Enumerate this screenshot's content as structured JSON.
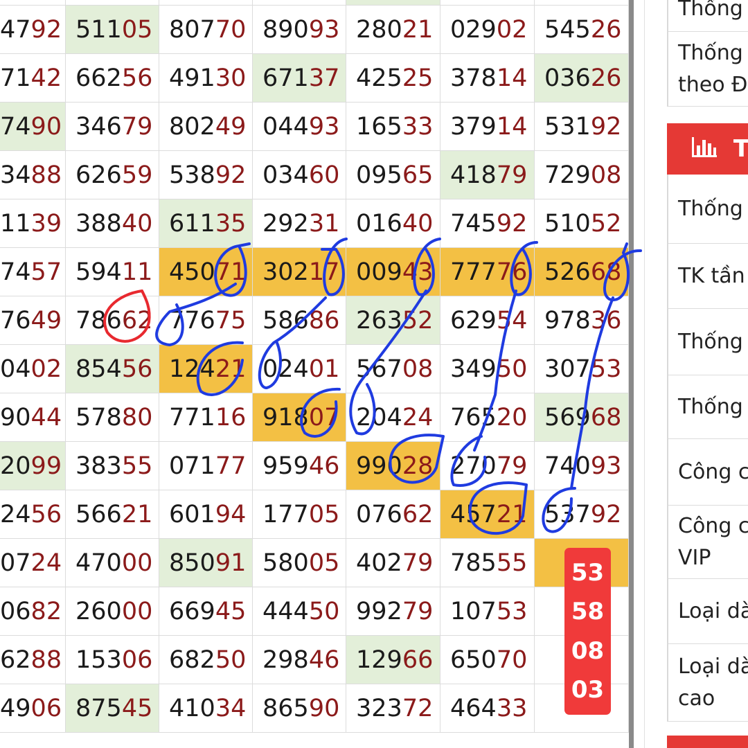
{
  "colors": {
    "tail_digits": "#8b1a1a",
    "highlight_gold": "#f3c044",
    "highlight_green": "#e3efd9",
    "header_red": "#e53935",
    "badge_red": "#f03a3a",
    "ink_blue": "#1f3be0",
    "ink_red": "#e8292f"
  },
  "rows": [
    {
      "cells": [
        {
          "head": "47",
          "tail": "92",
          "hl": ""
        },
        {
          "head": "511",
          "tail": "05",
          "hl": "green"
        },
        {
          "head": "807",
          "tail": "70",
          "hl": ""
        },
        {
          "head": "890",
          "tail": "93",
          "hl": ""
        },
        {
          "head": "280",
          "tail": "21",
          "hl": ""
        },
        {
          "head": "029",
          "tail": "02",
          "hl": ""
        },
        {
          "head": "545",
          "tail": "26",
          "hl": ""
        }
      ]
    },
    {
      "cells": [
        {
          "head": "71",
          "tail": "42",
          "hl": ""
        },
        {
          "head": "662",
          "tail": "56",
          "hl": ""
        },
        {
          "head": "491",
          "tail": "30",
          "hl": ""
        },
        {
          "head": "671",
          "tail": "37",
          "hl": "green"
        },
        {
          "head": "425",
          "tail": "25",
          "hl": ""
        },
        {
          "head": "378",
          "tail": "14",
          "hl": ""
        },
        {
          "head": "036",
          "tail": "26",
          "hl": "green"
        }
      ]
    },
    {
      "cells": [
        {
          "head": "74",
          "tail": "90",
          "hl": "green"
        },
        {
          "head": "346",
          "tail": "79",
          "hl": ""
        },
        {
          "head": "802",
          "tail": "49",
          "hl": ""
        },
        {
          "head": "044",
          "tail": "93",
          "hl": ""
        },
        {
          "head": "165",
          "tail": "33",
          "hl": ""
        },
        {
          "head": "379",
          "tail": "14",
          "hl": ""
        },
        {
          "head": "531",
          "tail": "92",
          "hl": ""
        }
      ]
    },
    {
      "cells": [
        {
          "head": "34",
          "tail": "88",
          "hl": ""
        },
        {
          "head": "626",
          "tail": "59",
          "hl": ""
        },
        {
          "head": "538",
          "tail": "92",
          "hl": ""
        },
        {
          "head": "034",
          "tail": "60",
          "hl": ""
        },
        {
          "head": "095",
          "tail": "65",
          "hl": ""
        },
        {
          "head": "418",
          "tail": "79",
          "hl": "green"
        },
        {
          "head": "729",
          "tail": "08",
          "hl": ""
        }
      ]
    },
    {
      "cells": [
        {
          "head": "11",
          "tail": "39",
          "hl": ""
        },
        {
          "head": "388",
          "tail": "40",
          "hl": ""
        },
        {
          "head": "611",
          "tail": "35",
          "hl": "green"
        },
        {
          "head": "292",
          "tail": "31",
          "hl": ""
        },
        {
          "head": "016",
          "tail": "40",
          "hl": ""
        },
        {
          "head": "745",
          "tail": "92",
          "hl": ""
        },
        {
          "head": "510",
          "tail": "52",
          "hl": ""
        }
      ]
    },
    {
      "cells": [
        {
          "head": "74",
          "tail": "57",
          "hl": ""
        },
        {
          "head": "594",
          "tail": "11",
          "hl": ""
        },
        {
          "head": "450",
          "tail": "71",
          "hl": "gold"
        },
        {
          "head": "302",
          "tail": "17",
          "hl": "gold"
        },
        {
          "head": "009",
          "tail": "43",
          "hl": "gold"
        },
        {
          "head": "777",
          "tail": "76",
          "hl": "gold"
        },
        {
          "head": "526",
          "tail": "68",
          "hl": "gold"
        }
      ]
    },
    {
      "cells": [
        {
          "head": "76",
          "tail": "49",
          "hl": ""
        },
        {
          "head": "786",
          "tail": "62",
          "hl": ""
        },
        {
          "head": "776",
          "tail": "75",
          "hl": ""
        },
        {
          "head": "586",
          "tail": "86",
          "hl": ""
        },
        {
          "head": "263",
          "tail": "52",
          "hl": "green"
        },
        {
          "head": "629",
          "tail": "54",
          "hl": ""
        },
        {
          "head": "978",
          "tail": "36",
          "hl": ""
        }
      ]
    },
    {
      "cells": [
        {
          "head": "04",
          "tail": "02",
          "hl": ""
        },
        {
          "head": "854",
          "tail": "56",
          "hl": "green"
        },
        {
          "head": "124",
          "tail": "21",
          "hl": "gold"
        },
        {
          "head": "024",
          "tail": "01",
          "hl": ""
        },
        {
          "head": "567",
          "tail": "08",
          "hl": ""
        },
        {
          "head": "349",
          "tail": "50",
          "hl": ""
        },
        {
          "head": "307",
          "tail": "53",
          "hl": ""
        }
      ]
    },
    {
      "cells": [
        {
          "head": "90",
          "tail": "44",
          "hl": ""
        },
        {
          "head": "578",
          "tail": "80",
          "hl": ""
        },
        {
          "head": "771",
          "tail": "16",
          "hl": ""
        },
        {
          "head": "918",
          "tail": "07",
          "hl": "gold"
        },
        {
          "head": "204",
          "tail": "24",
          "hl": ""
        },
        {
          "head": "765",
          "tail": "20",
          "hl": ""
        },
        {
          "head": "569",
          "tail": "68",
          "hl": "green"
        }
      ]
    },
    {
      "cells": [
        {
          "head": "20",
          "tail": "99",
          "hl": "green"
        },
        {
          "head": "383",
          "tail": "55",
          "hl": ""
        },
        {
          "head": "071",
          "tail": "77",
          "hl": ""
        },
        {
          "head": "959",
          "tail": "46",
          "hl": ""
        },
        {
          "head": "990",
          "tail": "28",
          "hl": "gold"
        },
        {
          "head": "270",
          "tail": "79",
          "hl": ""
        },
        {
          "head": "740",
          "tail": "93",
          "hl": ""
        }
      ]
    },
    {
      "cells": [
        {
          "head": "24",
          "tail": "56",
          "hl": ""
        },
        {
          "head": "566",
          "tail": "21",
          "hl": ""
        },
        {
          "head": "601",
          "tail": "94",
          "hl": ""
        },
        {
          "head": "177",
          "tail": "05",
          "hl": ""
        },
        {
          "head": "076",
          "tail": "62",
          "hl": ""
        },
        {
          "head": "457",
          "tail": "21",
          "hl": "gold"
        },
        {
          "head": "537",
          "tail": "92",
          "hl": ""
        }
      ]
    },
    {
      "cells": [
        {
          "head": "07",
          "tail": "24",
          "hl": ""
        },
        {
          "head": "470",
          "tail": "00",
          "hl": ""
        },
        {
          "head": "850",
          "tail": "91",
          "hl": "green"
        },
        {
          "head": "580",
          "tail": "05",
          "hl": ""
        },
        {
          "head": "402",
          "tail": "79",
          "hl": ""
        },
        {
          "head": "785",
          "tail": "55",
          "hl": ""
        },
        {
          "head": "",
          "tail": "",
          "hl": "gold"
        }
      ]
    },
    {
      "cells": [
        {
          "head": "06",
          "tail": "82",
          "hl": ""
        },
        {
          "head": "260",
          "tail": "00",
          "hl": ""
        },
        {
          "head": "669",
          "tail": "45",
          "hl": ""
        },
        {
          "head": "444",
          "tail": "50",
          "hl": ""
        },
        {
          "head": "992",
          "tail": "79",
          "hl": ""
        },
        {
          "head": "107",
          "tail": "53",
          "hl": ""
        },
        {
          "head": "",
          "tail": "",
          "hl": ""
        }
      ]
    },
    {
      "cells": [
        {
          "head": "62",
          "tail": "88",
          "hl": ""
        },
        {
          "head": "153",
          "tail": "06",
          "hl": ""
        },
        {
          "head": "682",
          "tail": "50",
          "hl": ""
        },
        {
          "head": "298",
          "tail": "46",
          "hl": ""
        },
        {
          "head": "129",
          "tail": "66",
          "hl": "green"
        },
        {
          "head": "650",
          "tail": "70",
          "hl": ""
        },
        {
          "head": "",
          "tail": "",
          "hl": ""
        }
      ]
    },
    {
      "cells": [
        {
          "head": "49",
          "tail": "06",
          "hl": ""
        },
        {
          "head": "875",
          "tail": "45",
          "hl": "green"
        },
        {
          "head": "410",
          "tail": "34",
          "hl": ""
        },
        {
          "head": "865",
          "tail": "90",
          "hl": ""
        },
        {
          "head": "323",
          "tail": "72",
          "hl": ""
        },
        {
          "head": "464",
          "tail": "33",
          "hl": ""
        },
        {
          "head": "",
          "tail": "",
          "hl": ""
        }
      ]
    }
  ],
  "result_badge": [
    "53",
    "58",
    "08",
    "03"
  ],
  "sidebar": {
    "header_label": "Th",
    "header_icon": "bar-chart-icon",
    "items": [
      {
        "lines": [
          "Thống"
        ]
      },
      {
        "lines": [
          "Thống",
          "theo Đă"
        ]
      },
      {
        "lines": [
          "Thống"
        ]
      },
      {
        "lines": [
          "TK tần"
        ]
      },
      {
        "lines": [
          "Thống"
        ]
      },
      {
        "lines": [
          "Thống"
        ]
      },
      {
        "lines": [
          "Công c"
        ]
      },
      {
        "lines": [
          "Công c",
          "VIP"
        ]
      },
      {
        "lines": [
          "Loại dà"
        ]
      },
      {
        "lines": [
          "Loại dà",
          "cao"
        ]
      }
    ]
  }
}
